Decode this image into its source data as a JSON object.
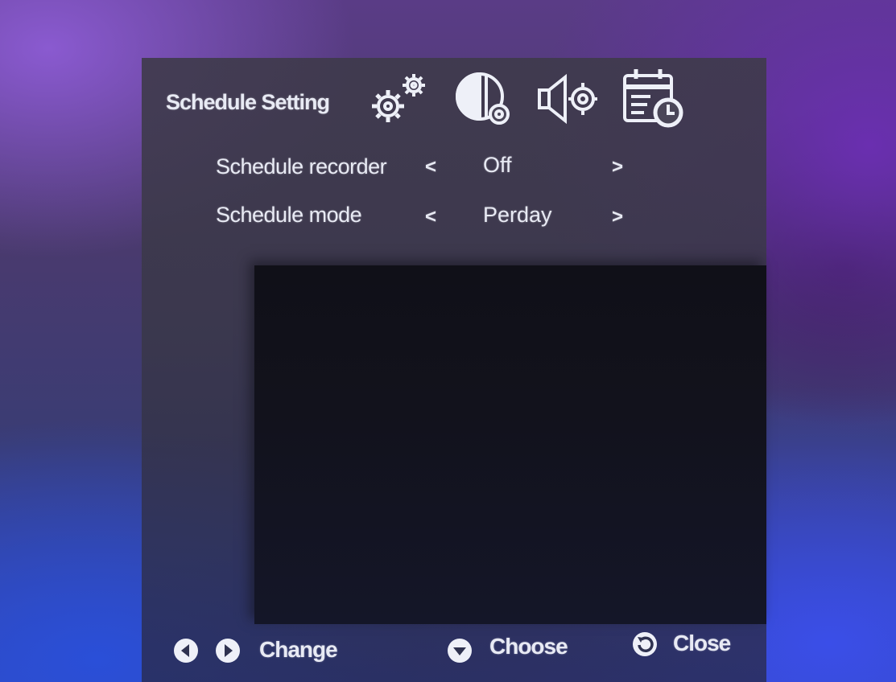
{
  "menu": {
    "title": "Schedule Setting",
    "tab_icons": [
      "gears-icon",
      "display-settings-icon",
      "audio-settings-icon",
      "calendar-clock-icon"
    ]
  },
  "settings": [
    {
      "label": "Schedule recorder",
      "value": "Off",
      "prev": "<",
      "next": ">"
    },
    {
      "label": "Schedule mode",
      "value": "Perday",
      "prev": "<",
      "next": ">"
    }
  ],
  "footer": {
    "change_label": "Change",
    "choose_label": "Choose",
    "close_label": "Close"
  },
  "colors": {
    "text": "#e8eaf4",
    "panel": "#3e3a4a",
    "video_area": "#101018"
  }
}
